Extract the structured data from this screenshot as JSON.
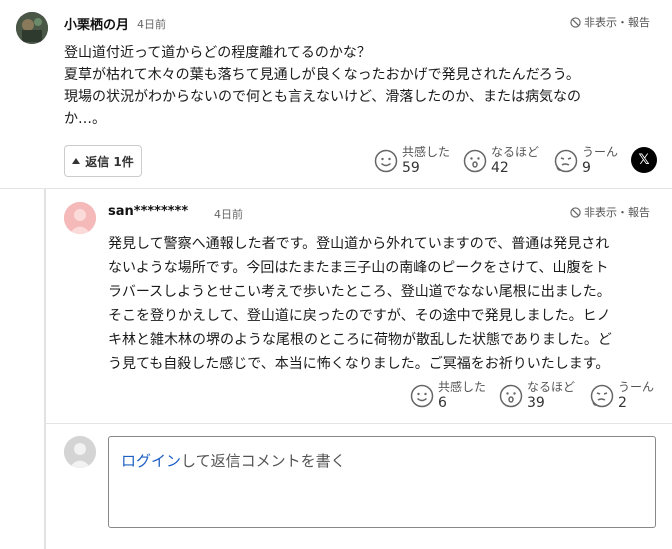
{
  "main_comment": {
    "author": "小栗栖の月",
    "time": "4日前",
    "hide_report": "非表示・報告",
    "lines": [
      "登山道付近って道からどの程度離れてるのかな？",
      "夏草が枯れて木々の葉も落ちて見通しが良くなったおかげで発見されたんだろう。",
      "現場の状況がわからないので何とも言えないけど、滑落したのか、または病気なの",
      "か…。"
    ],
    "reply_button": "返信 1件",
    "reactions": [
      {
        "icon": "empathy-icon",
        "label": "共感した",
        "count": "59"
      },
      {
        "icon": "insight-icon",
        "label": "なるほど",
        "count": "42"
      },
      {
        "icon": "hmm-icon",
        "label": "うーん",
        "count": "9"
      }
    ],
    "share_icon": "x-share-icon"
  },
  "reply_comment": {
    "author": "san********",
    "time": "4日前",
    "hide_report": "非表示・報告",
    "lines": [
      "発見して警察へ通報した者です。登山道から外れていますので、普通は発見され",
      "ないような場所です。今回はたまたま三子山の南峰のピークをさけて、山腹をト",
      "ラバースしようとせこい考えで歩いたところ、登山道でなない尾根に出ました。",
      "そこを登りかえして、登山道に戻ったのですが、その途中で発見しました。ヒノ",
      "キ林と雑木林の堺のような尾根のところに荷物が散乱した状態でありました。ど",
      "う見ても自殺した感じで、本当に怖くなりました。ご冥福をお祈りいたします。"
    ],
    "reactions": [
      {
        "icon": "empathy-icon",
        "label": "共感した",
        "count": "6"
      },
      {
        "icon": "insight-icon",
        "label": "なるほど",
        "count": "39"
      },
      {
        "icon": "hmm-icon",
        "label": "うーん",
        "count": "2"
      }
    ]
  },
  "reply_input": {
    "login_link": "ログイン",
    "placeholder_rest": "して返信コメントを書く"
  }
}
